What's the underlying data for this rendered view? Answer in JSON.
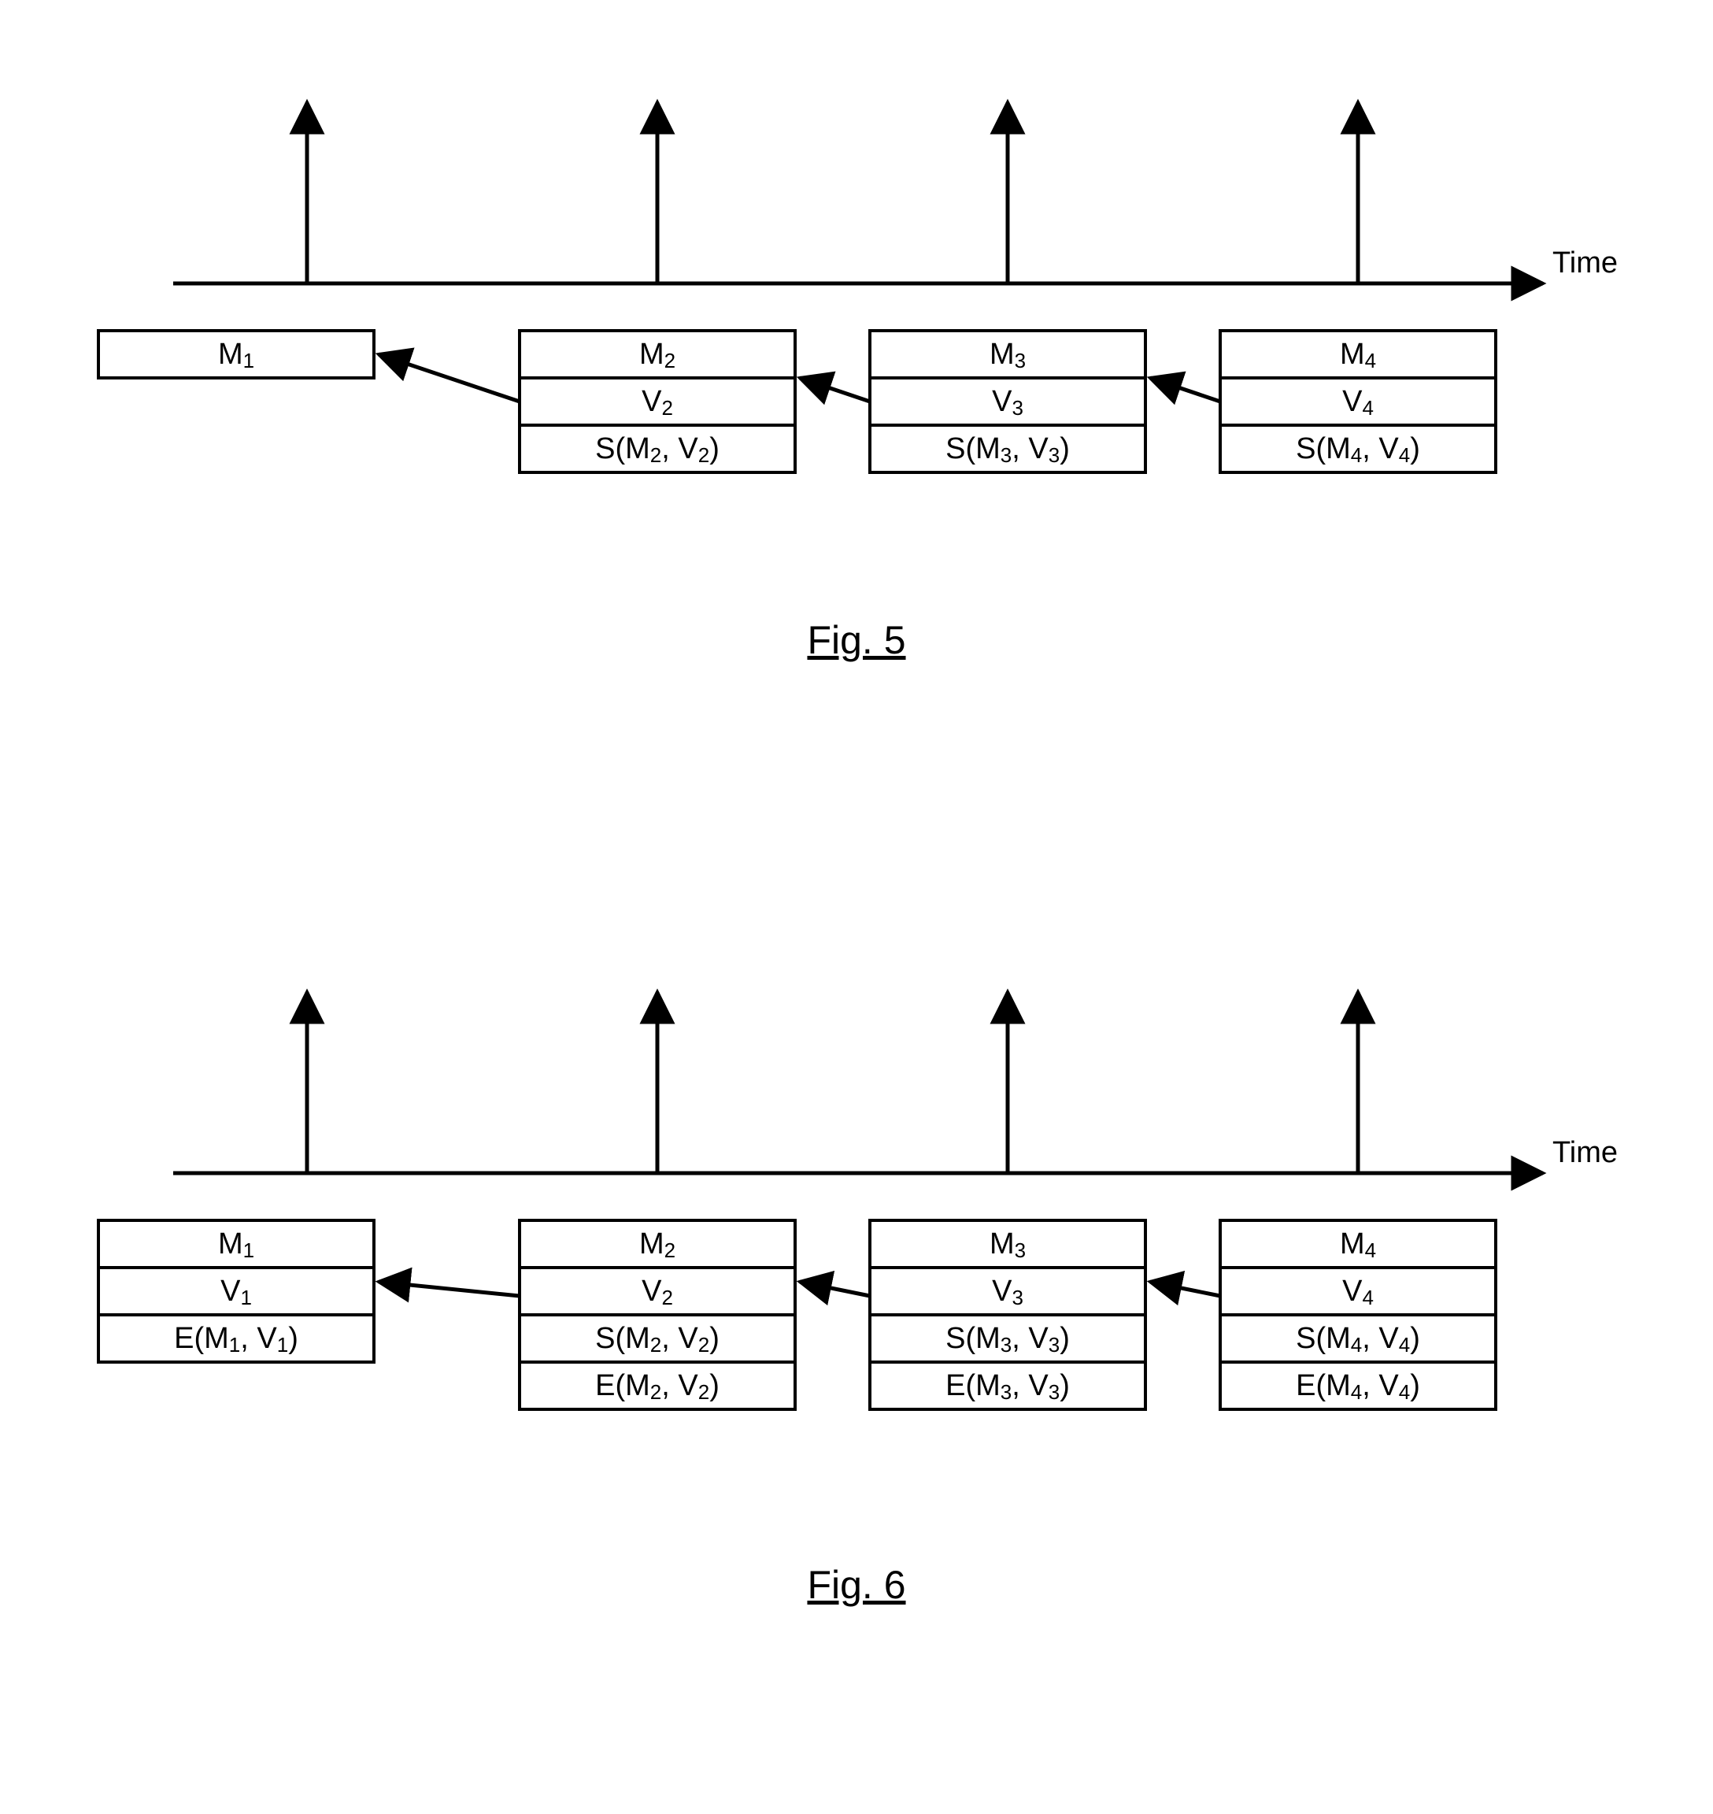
{
  "axis": {
    "label": "Time"
  },
  "figures": {
    "fig5": {
      "caption": "Fig. 5",
      "blocks": [
        {
          "rows": [
            "M1"
          ]
        },
        {
          "rows": [
            "M2",
            "V2",
            "S(M2, V2)"
          ]
        },
        {
          "rows": [
            "M3",
            "V3",
            "S(M3, V3)"
          ]
        },
        {
          "rows": [
            "M4",
            "V4",
            "S(M4, V4)"
          ]
        }
      ]
    },
    "fig6": {
      "caption": "Fig. 6",
      "blocks": [
        {
          "rows": [
            "M1",
            "V1",
            "E(M1, V1)"
          ]
        },
        {
          "rows": [
            "M2",
            "V2",
            "S(M2, V2)",
            "E(M2, V2)"
          ]
        },
        {
          "rows": [
            "M3",
            "V3",
            "S(M3, V3)",
            "E(M3, V3)"
          ]
        },
        {
          "rows": [
            "M4",
            "V4",
            "S(M4, V4)",
            "E(M4, V4)"
          ]
        }
      ]
    }
  }
}
